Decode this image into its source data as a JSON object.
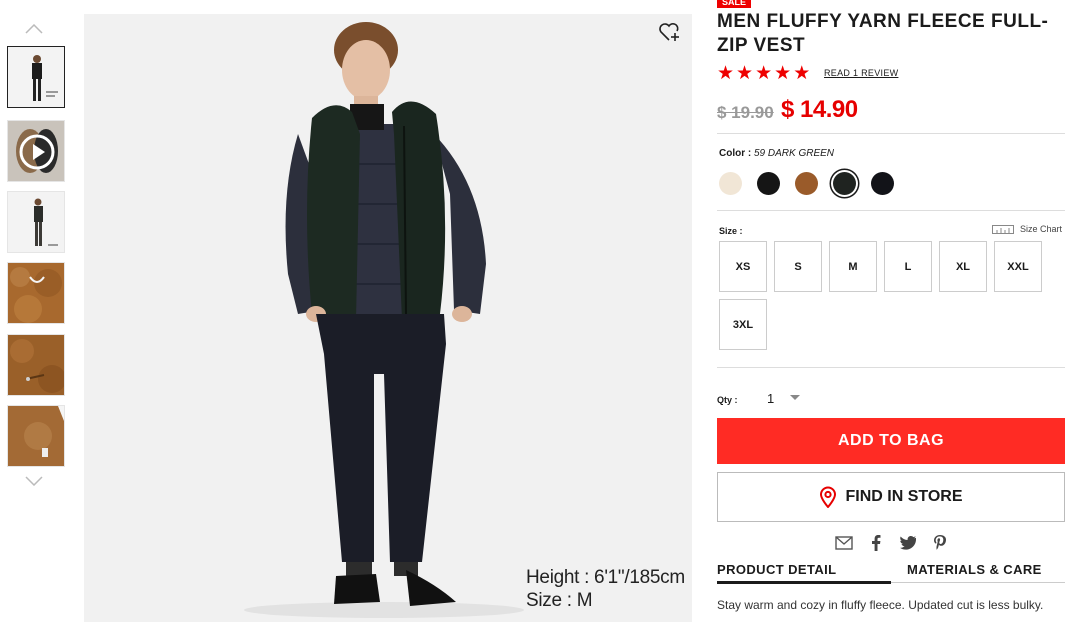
{
  "thumbnails": {
    "up_icon": "chevron-up-icon",
    "down_icon": "chevron-down-icon",
    "items": [
      {
        "kind": "model-front",
        "color": "#2a2a2a",
        "active": true
      },
      {
        "kind": "video",
        "color": "#8a6a4a",
        "active": false
      },
      {
        "kind": "model-side",
        "color": "#3a3a3a",
        "active": false
      },
      {
        "kind": "fleece-collar",
        "color": "#a8692e",
        "active": false
      },
      {
        "kind": "fleece-pocket",
        "color": "#9a6029",
        "active": false
      },
      {
        "kind": "fleece-detail",
        "color": "#a36a35",
        "active": false
      }
    ]
  },
  "main_image": {
    "caption_height": "Height : 6'1\"/185cm",
    "caption_size": "Size : M",
    "wishlist_icon": "heart-plus-icon"
  },
  "product": {
    "badge": "SALE",
    "title": "MEN FLUFFY YARN FLEECE FULL-ZIP VEST",
    "rating": 5,
    "review_link": "READ 1 REVIEW",
    "old_price": "$ 19.90",
    "price": "$ 14.90",
    "color_label": "Color :",
    "color_value": "59 DARK GREEN",
    "colors": [
      {
        "name": "off-white",
        "hex": "#f1e6d6",
        "selected": false
      },
      {
        "name": "black",
        "hex": "#151515",
        "selected": false
      },
      {
        "name": "brown",
        "hex": "#9a5b2a",
        "selected": false
      },
      {
        "name": "dark-green",
        "hex": "#1f2320",
        "selected": true
      },
      {
        "name": "navy",
        "hex": "#121318",
        "selected": false
      }
    ],
    "size_label": "Size :",
    "size_chart_label": "Size Chart",
    "sizes": [
      "XS",
      "S",
      "M",
      "L",
      "XL",
      "XXL",
      "3XL"
    ],
    "qty_label": "Qty :",
    "qty_value": "1",
    "add_to_bag": "ADD TO BAG",
    "find_in_store": "FIND IN STORE",
    "social_icons": [
      "mail-icon",
      "facebook-icon",
      "twitter-icon",
      "pinterest-icon"
    ],
    "tabs": [
      "PRODUCT DETAIL",
      "MATERIALS & CARE"
    ],
    "description": "Stay warm and cozy in fluffy fleece. Updated cut is less bulky."
  },
  "colors": {
    "accent": "#ff2b24",
    "price_red": "#e60000",
    "star_red": "#e00000"
  }
}
